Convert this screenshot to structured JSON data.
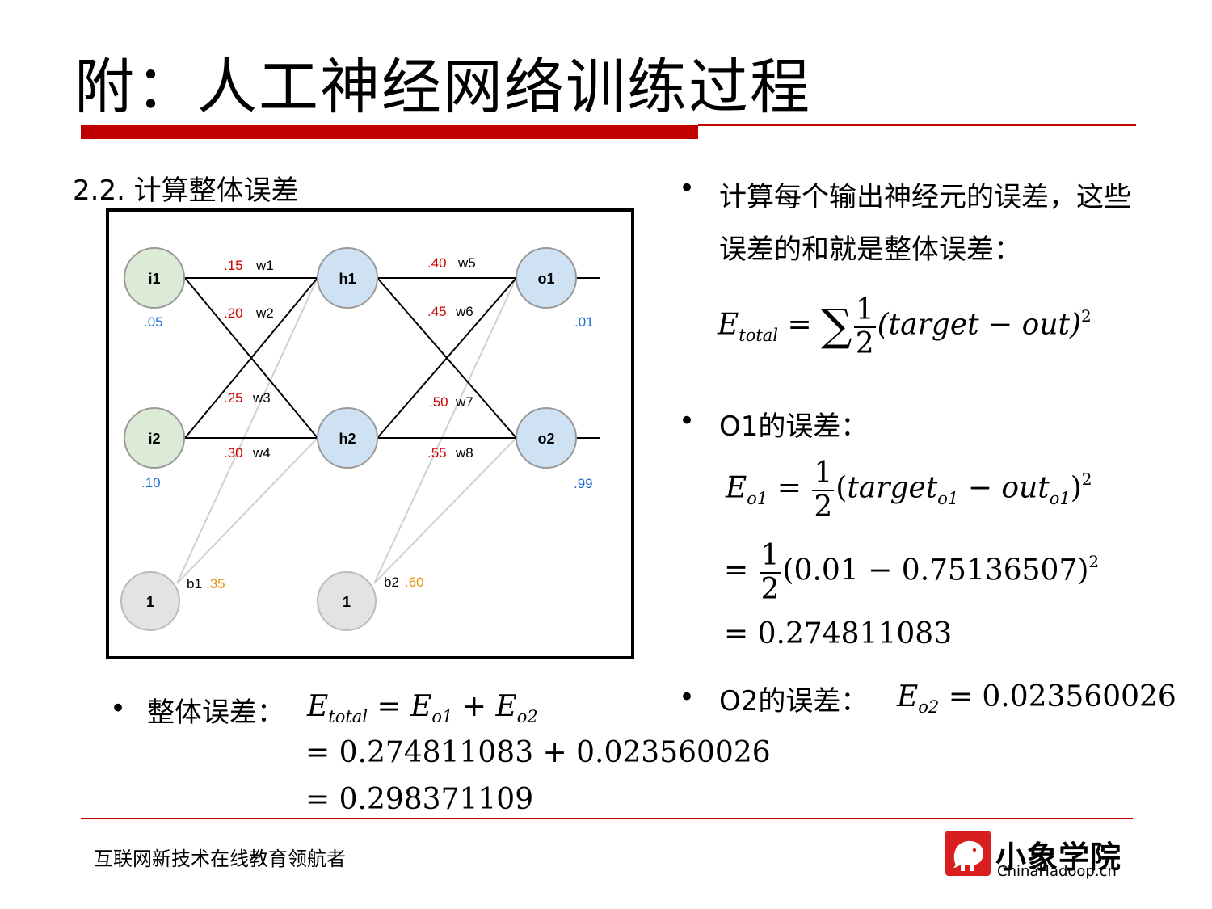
{
  "title": "附：人工神经网络训练过程",
  "section": "2.2. 计算整体误差",
  "colors": {
    "accent": "#c00000",
    "weight_label": "#d00000",
    "value_label": "#1f6fd0",
    "bias_label": "#e8900a",
    "input_node": "#dcebd5",
    "hidden_node": "#cfe2f3",
    "bias_node": "#e3e3e3"
  },
  "diagram": {
    "nodes": [
      {
        "id": "i1",
        "label": "i1"
      },
      {
        "id": "i2",
        "label": "i2"
      },
      {
        "id": "h1",
        "label": "h1"
      },
      {
        "id": "h2",
        "label": "h2"
      },
      {
        "id": "o1",
        "label": "o1"
      },
      {
        "id": "o2",
        "label": "o2"
      },
      {
        "id": "b1n",
        "label": "1"
      },
      {
        "id": "b2n",
        "label": "1"
      }
    ],
    "weights": [
      {
        "value": ".15",
        "name": "w1"
      },
      {
        "value": ".20",
        "name": "w2"
      },
      {
        "value": ".25",
        "name": "w3"
      },
      {
        "value": ".30",
        "name": "w4"
      },
      {
        "value": ".40",
        "name": "w5"
      },
      {
        "value": ".45",
        "name": "w6"
      },
      {
        "value": ".50",
        "name": "w7"
      },
      {
        "value": ".55",
        "name": "w8"
      }
    ],
    "inputs": {
      "i1": ".05",
      "i2": ".10"
    },
    "targets": {
      "o1": ".01",
      "o2": ".99"
    },
    "biases": [
      {
        "name": "b1",
        "value": ".35"
      },
      {
        "name": "b2",
        "value": ".60"
      }
    ]
  },
  "right": {
    "bullet1_line1": "计算每个输出神经元的误差，这些",
    "bullet1_line2": "误差的和就是整体误差：",
    "eq_total": {
      "E": "E",
      "sub": "total",
      "eq": "=",
      "sum": "∑",
      "num": "1",
      "den": "2",
      "body": "(target − out)",
      "pow": "2"
    },
    "bullet2": "O1的误差：",
    "eq_o1_line1": {
      "E": "E",
      "sub": "o1",
      "eq": "=",
      "num": "1",
      "den": "2",
      "open": "(",
      "t": "target",
      "tsub": "o1",
      "minus": " − ",
      "o": "out",
      "osub": "o1",
      "close": ")",
      "pow": "2"
    },
    "eq_o1_line2": {
      "eq": "=",
      "num": "1",
      "den": "2",
      "body": "(0.01 − 0.75136507)",
      "pow": "2"
    },
    "eq_o1_line3": "= 0.274811083",
    "bullet3": "O2的误差：",
    "eq_o2": {
      "E": "E",
      "sub": "o2",
      "rest": " = 0.023560026"
    }
  },
  "left_bottom": {
    "bullet": "整体误差：",
    "eq_line1": {
      "E": "E",
      "sub": "total",
      "mid": " = ",
      "E2": "E",
      "sub2": "o1",
      "plus": " + ",
      "E3": "E",
      "sub3": "o2"
    },
    "eq_line2": "= 0.274811083 + 0.023560026",
    "eq_line3": "= 0.298371109"
  },
  "footer": {
    "slogan": "互联网新技术在线教育领航者",
    "logo_name": "小象学院",
    "logo_url": "ChinaHadoop.cn"
  }
}
